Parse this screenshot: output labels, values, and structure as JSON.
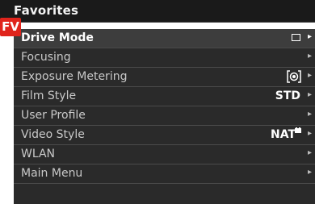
{
  "header": {
    "title": "Favorites"
  },
  "badge": {
    "text": "FV",
    "color": "#e0241c"
  },
  "menu": {
    "items": [
      {
        "label": "Drive Mode",
        "icon": "single-frame-icon",
        "selected": true
      },
      {
        "label": "Focusing"
      },
      {
        "label": "Exposure Metering",
        "icon": "spot-metering-icon"
      },
      {
        "label": "Film Style",
        "value": "STD"
      },
      {
        "label": "User Profile"
      },
      {
        "label": "Video Style",
        "value": "NAT",
        "icon": "cine-superscript-icon"
      },
      {
        "label": "WLAN"
      },
      {
        "label": "Main Menu"
      }
    ]
  }
}
